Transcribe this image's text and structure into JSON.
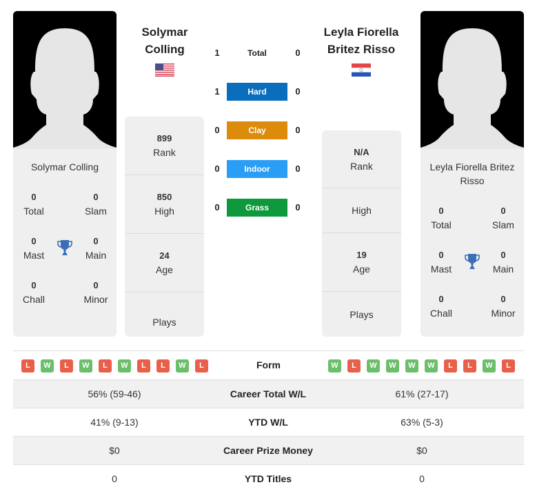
{
  "player1": {
    "name": "Solymar Colling",
    "name_line1": "Solymar",
    "name_line2": "Colling",
    "flag": "flag-usa",
    "titles": {
      "total": {
        "value": "0",
        "label": "Total"
      },
      "slam": {
        "value": "0",
        "label": "Slam"
      },
      "mast": {
        "value": "0",
        "label": "Mast"
      },
      "main": {
        "value": "0",
        "label": "Main"
      },
      "chall": {
        "value": "0",
        "label": "Chall"
      },
      "minor": {
        "value": "0",
        "label": "Minor"
      }
    },
    "info": {
      "rank": {
        "value": "899",
        "label": "Rank"
      },
      "high": {
        "value": "850",
        "label": "High"
      },
      "age": {
        "value": "24",
        "label": "Age"
      },
      "plays": {
        "value": "",
        "label": "Plays"
      }
    },
    "form": [
      "L",
      "W",
      "L",
      "W",
      "L",
      "W",
      "L",
      "L",
      "W",
      "L"
    ]
  },
  "player2": {
    "name": "Leyla Fiorella Britez Risso",
    "name_line1": "Leyla Fiorella",
    "name_line2": "Britez Risso",
    "flag": "flag-paraguay",
    "titles": {
      "total": {
        "value": "0",
        "label": "Total"
      },
      "slam": {
        "value": "0",
        "label": "Slam"
      },
      "mast": {
        "value": "0",
        "label": "Mast"
      },
      "main": {
        "value": "0",
        "label": "Main"
      },
      "chall": {
        "value": "0",
        "label": "Chall"
      },
      "minor": {
        "value": "0",
        "label": "Minor"
      }
    },
    "info": {
      "rank": {
        "value": "N/A",
        "label": "Rank"
      },
      "high": {
        "value": "",
        "label": "High"
      },
      "age": {
        "value": "19",
        "label": "Age"
      },
      "plays": {
        "value": "",
        "label": "Plays"
      }
    },
    "form": [
      "W",
      "L",
      "W",
      "W",
      "W",
      "W",
      "L",
      "L",
      "W",
      "L"
    ]
  },
  "h2h": [
    {
      "surface": "Total",
      "p1": "1",
      "p2": "0",
      "color": ""
    },
    {
      "surface": "Hard",
      "p1": "1",
      "p2": "0",
      "color": "#0a6ebd"
    },
    {
      "surface": "Clay",
      "p1": "0",
      "p2": "0",
      "color": "#dc8c0a"
    },
    {
      "surface": "Indoor",
      "p1": "0",
      "p2": "0",
      "color": "#2a9df4"
    },
    {
      "surface": "Grass",
      "p1": "0",
      "p2": "0",
      "color": "#0e9a3c"
    }
  ],
  "form_label": "Form",
  "stats": [
    {
      "label": "Career Total W/L",
      "p1": "56% (59-46)",
      "p2": "61% (27-17)"
    },
    {
      "label": "YTD W/L",
      "p1": "41% (9-13)",
      "p2": "63% (5-3)"
    },
    {
      "label": "Career Prize Money",
      "p1": "$0",
      "p2": "$0"
    },
    {
      "label": "YTD Titles",
      "p1": "0",
      "p2": "0"
    }
  ],
  "colors": {
    "win": "#6cbf6a",
    "loss": "#e8604a",
    "trophy": "#3a6fb8"
  }
}
